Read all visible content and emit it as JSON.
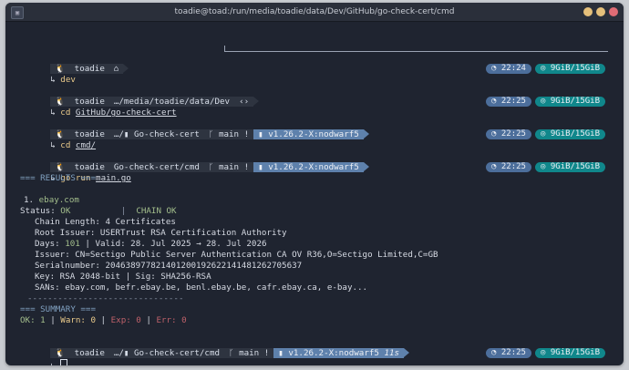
{
  "window": {
    "title": "toadie@toad:/run/media/toadie/data/Dev/GitHub/go-check-cert/cmd",
    "btn_colors": [
      "#e5c07b",
      "#e5c07b",
      "#e06c75"
    ]
  },
  "prompts": [
    {
      "user": "toadie",
      "path": "",
      "home": "⌂",
      "branch": "",
      "go": "",
      "arrow": "↳",
      "cmd": "dev",
      "arg": "",
      "time": "22:24",
      "mem": "9GiB/15GiB"
    },
    {
      "user": "toadie",
      "path": "…/media/toadie/data/Dev",
      "home": "‹›",
      "branch": "",
      "go": "",
      "arrow": "↳",
      "cmd": "cd",
      "arg": "GitHub/go-check-cert",
      "time": "22:25",
      "mem": "9GiB/15GiB"
    },
    {
      "user": "toadie",
      "path": "…/▮ Go-check-cert",
      "home": "",
      "branch": "main !",
      "go": "v1.26.2-X:nodwarf5",
      "arrow": "↳",
      "cmd": "cd",
      "arg": "cmd/",
      "time": "22:25",
      "mem": "9GiB/15GiB"
    },
    {
      "user": "toadie",
      "path": "Go-check-cert/cmd",
      "home": "",
      "branch": "main !",
      "go": "v1.26.2-X:nodwarf5",
      "arrow": "↳",
      "cmd": "go run",
      "arg": "main.go",
      "time": "22:25",
      "mem": "9GiB/15GiB"
    }
  ],
  "output": {
    "results_header": "=== RESULTS ===",
    "item_index": "1.",
    "item_host": "ebay.com",
    "status_label": "Status:",
    "status_ok": "OK",
    "chain_ok": "CHAIN OK",
    "chain_length": "Chain Length: 4 Certificates",
    "root_issuer": "Root Issuer: USERTrust RSA Certification Authority",
    "days_label": "Days:",
    "days_value": "101",
    "valid": "| Valid: 28. Jul 2025 → 28. Jul 2026",
    "issuer": "Issuer: CN=Sectigo Public Server Authentication CA OV R36,O=Sectigo Limited,C=GB",
    "serial": "Serialnumber: 204638977821401200192622141481262705637",
    "key": "Key: RSA 2048-bit | Sig: SHA256-RSA",
    "sans": "SANs: ebay.com, befr.ebay.be, benl.ebay.be, cafr.ebay.ca, e-bay...",
    "divider": "-------------------------------",
    "summary_header": "=== SUMMARY ===",
    "ok": "OK: 1",
    "warn": "Warn: 0",
    "exp": "Exp: 0",
    "err": "Err: 0"
  },
  "final_prompt": {
    "user": "toadie",
    "path": "…/▮ Go-check-cert/cmd",
    "branch": "main !",
    "go": "v1.26.2-X:nodwarf5",
    "duration": "11s",
    "arrow": "↳",
    "time": "22:25",
    "mem": "9GiB/15GiB"
  }
}
